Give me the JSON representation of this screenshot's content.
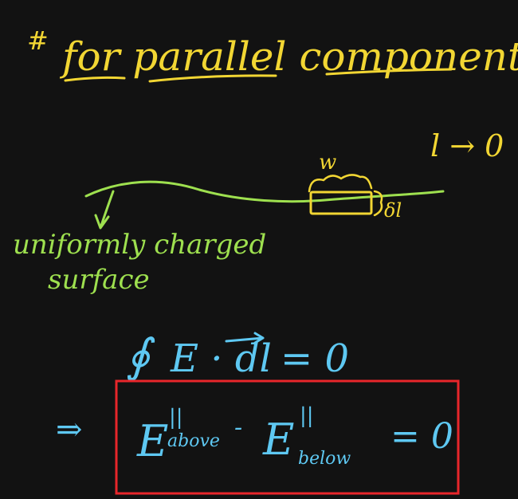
{
  "colors": {
    "background": "#121212",
    "yellow_ink": "#f2d633",
    "green_ink": "#9ee04f",
    "blue_ink": "#5ec8f2",
    "box_red": "#e8262b"
  },
  "heading": {
    "hash": "#",
    "text": "for parallel component"
  },
  "limit_note": "l → 0",
  "loop_labels": {
    "width": "w",
    "side": "δl"
  },
  "surface_label": {
    "line1": "uniformly charged",
    "line2": "surface"
  },
  "equation1": {
    "integral": "∮",
    "expr": "E · dl",
    "equals": "= 0"
  },
  "equation2": {
    "implies": "⇒",
    "e1": "E",
    "sup1": "||",
    "sub1": "above",
    "minus": "-",
    "e2": "E",
    "sup2": "||",
    "sub2": "below",
    "equals": "= 0"
  }
}
